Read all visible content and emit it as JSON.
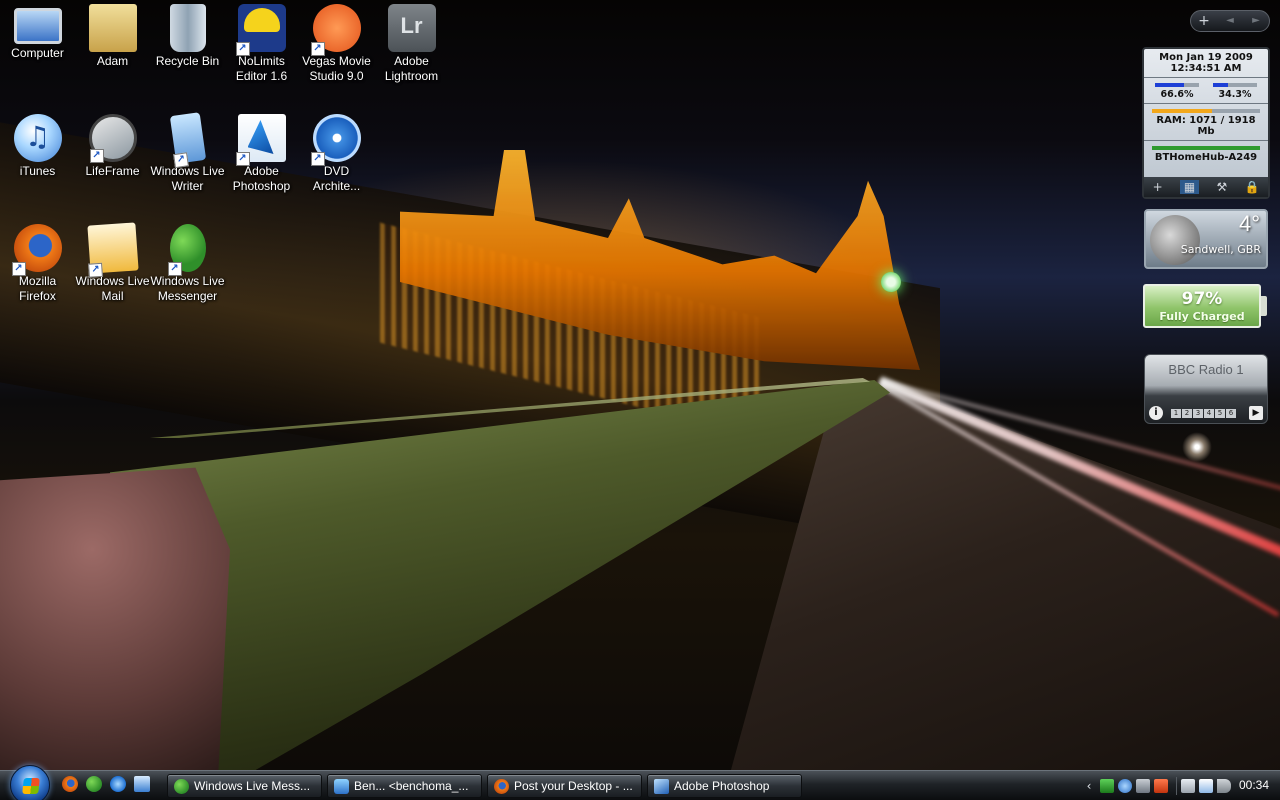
{
  "desktop": {
    "icons": [
      {
        "label": "Computer",
        "icon": "computer-icon"
      },
      {
        "label": "Adam",
        "icon": "user-folder-icon"
      },
      {
        "label": "Recycle Bin",
        "icon": "recycle-bin-icon"
      },
      {
        "label": "NoLimits Editor 1.6",
        "icon": "nolimits-editor-icon"
      },
      {
        "label": "Vegas Movie Studio 9.0",
        "icon": "vegas-movie-studio-icon"
      },
      {
        "label": "Adobe Lightroom",
        "icon": "lightroom-icon",
        "glyph": "Lr"
      },
      {
        "label": "iTunes",
        "icon": "itunes-icon",
        "glyph": "♫"
      },
      {
        "label": "LifeFrame",
        "icon": "lifeframe-icon"
      },
      {
        "label": "Windows Live Writer",
        "icon": "live-writer-icon"
      },
      {
        "label": "Adobe Photoshop",
        "icon": "photoshop-icon"
      },
      {
        "label": "DVD Archite...",
        "icon": "dvd-architect-icon"
      },
      {
        "label": "Mozilla Firefox",
        "icon": "firefox-icon"
      },
      {
        "label": "Windows Live Mail",
        "icon": "live-mail-icon"
      },
      {
        "label": "Windows Live Messenger",
        "icon": "live-messenger-icon"
      }
    ]
  },
  "sidebar": {
    "topbar": {
      "add": "+",
      "prev": "◄",
      "next": "►"
    },
    "system_monitor": {
      "date": "Mon Jan 19 2009",
      "time": "12:34:51 AM",
      "cpu": [
        {
          "label": "66.6%",
          "level": 0.666
        },
        {
          "label": "34.3%",
          "level": 0.343
        }
      ],
      "ram": {
        "label": "RAM: 1071 / 1918 Mb",
        "level": 0.558
      },
      "network": {
        "label": "BTHomeHub-A249",
        "level": 1.0
      },
      "tools": [
        "+",
        "▦",
        "⚒",
        "🔒"
      ]
    },
    "weather": {
      "temperature": "4°",
      "location": "Sandwell, GBR"
    },
    "battery": {
      "percent": "97%",
      "status": "Fully Charged",
      "level": 0.97
    },
    "radio": {
      "station": "BBC Radio 1",
      "info": "i",
      "presets": [
        "1",
        "2",
        "3",
        "4",
        "5",
        "6"
      ],
      "play": "▶"
    }
  },
  "taskbar": {
    "quick_launch": [
      "firefox-icon",
      "messenger-icon",
      "internet-explorer-icon",
      "show-desktop-icon"
    ],
    "tasks": [
      {
        "label": "Windows Live Mess...",
        "icon": "live-messenger-icon"
      },
      {
        "label": "Ben... <benchoma_...",
        "icon": "chat-window-icon"
      },
      {
        "label": "Post your Desktop - ...",
        "icon": "firefox-icon"
      },
      {
        "label": "Adobe Photoshop",
        "icon": "photoshop-icon"
      }
    ],
    "tray": {
      "chevron": "‹",
      "clock": "00:34"
    }
  }
}
